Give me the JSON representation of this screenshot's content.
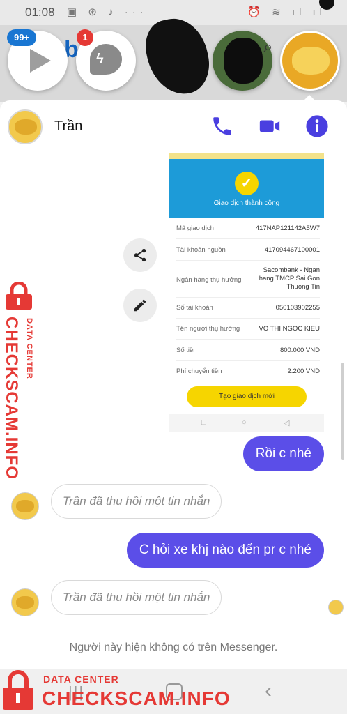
{
  "status_bar": {
    "time": "01:08",
    "left_icons": "▣ ⊛ ♪ ···",
    "right_icons": "⏰ ≋ ıl ıl"
  },
  "chat_heads": {
    "play_badge": "99+",
    "messenger_badge": "1"
  },
  "chat_header": {
    "contact_name": "Trần",
    "icons": [
      "phone-icon",
      "video-call-icon",
      "info-icon"
    ],
    "accent_color": "#4a3fe0"
  },
  "shared_image": {
    "success_text": "Giao dịch thành công",
    "rows": [
      {
        "label": "Mã giao dịch",
        "value": "417NAP121142A5W7"
      },
      {
        "label": "Tài khoản nguồn",
        "value": "417094467100001"
      },
      {
        "label": "Ngân hàng thụ hưởng",
        "value": "Sacombank - Ngan hang TMCP Sai Gon Thuong Tin"
      },
      {
        "label": "Số tài khoản",
        "value": "050103902255"
      },
      {
        "label": "Tên người thụ hưởng",
        "value": "VO THI NGOC KIEU"
      },
      {
        "label": "Số tiền",
        "value": "800.000 VND"
      },
      {
        "label": "Phí chuyển tiền",
        "value": "2.200 VND"
      }
    ],
    "button_label": "Tạo giao dịch mới"
  },
  "messages": [
    {
      "type": "outgoing",
      "text": "Rồi c nhé"
    },
    {
      "type": "unsent",
      "text": "Trần đã thu hồi một tin nhắn"
    },
    {
      "type": "outgoing",
      "text": "C hỏi xe khj nào đến pr c nhé"
    },
    {
      "type": "unsent",
      "text": "Trần đã thu hồi một tin nhắn"
    }
  ],
  "notice": "Người này hiện không có trên Messenger.",
  "watermark": {
    "small": "DATA CENTER",
    "big": "CHECKSCAM.INFO",
    "color": "#e53935"
  },
  "outgoing_bubble_color": "#5b4ee8"
}
